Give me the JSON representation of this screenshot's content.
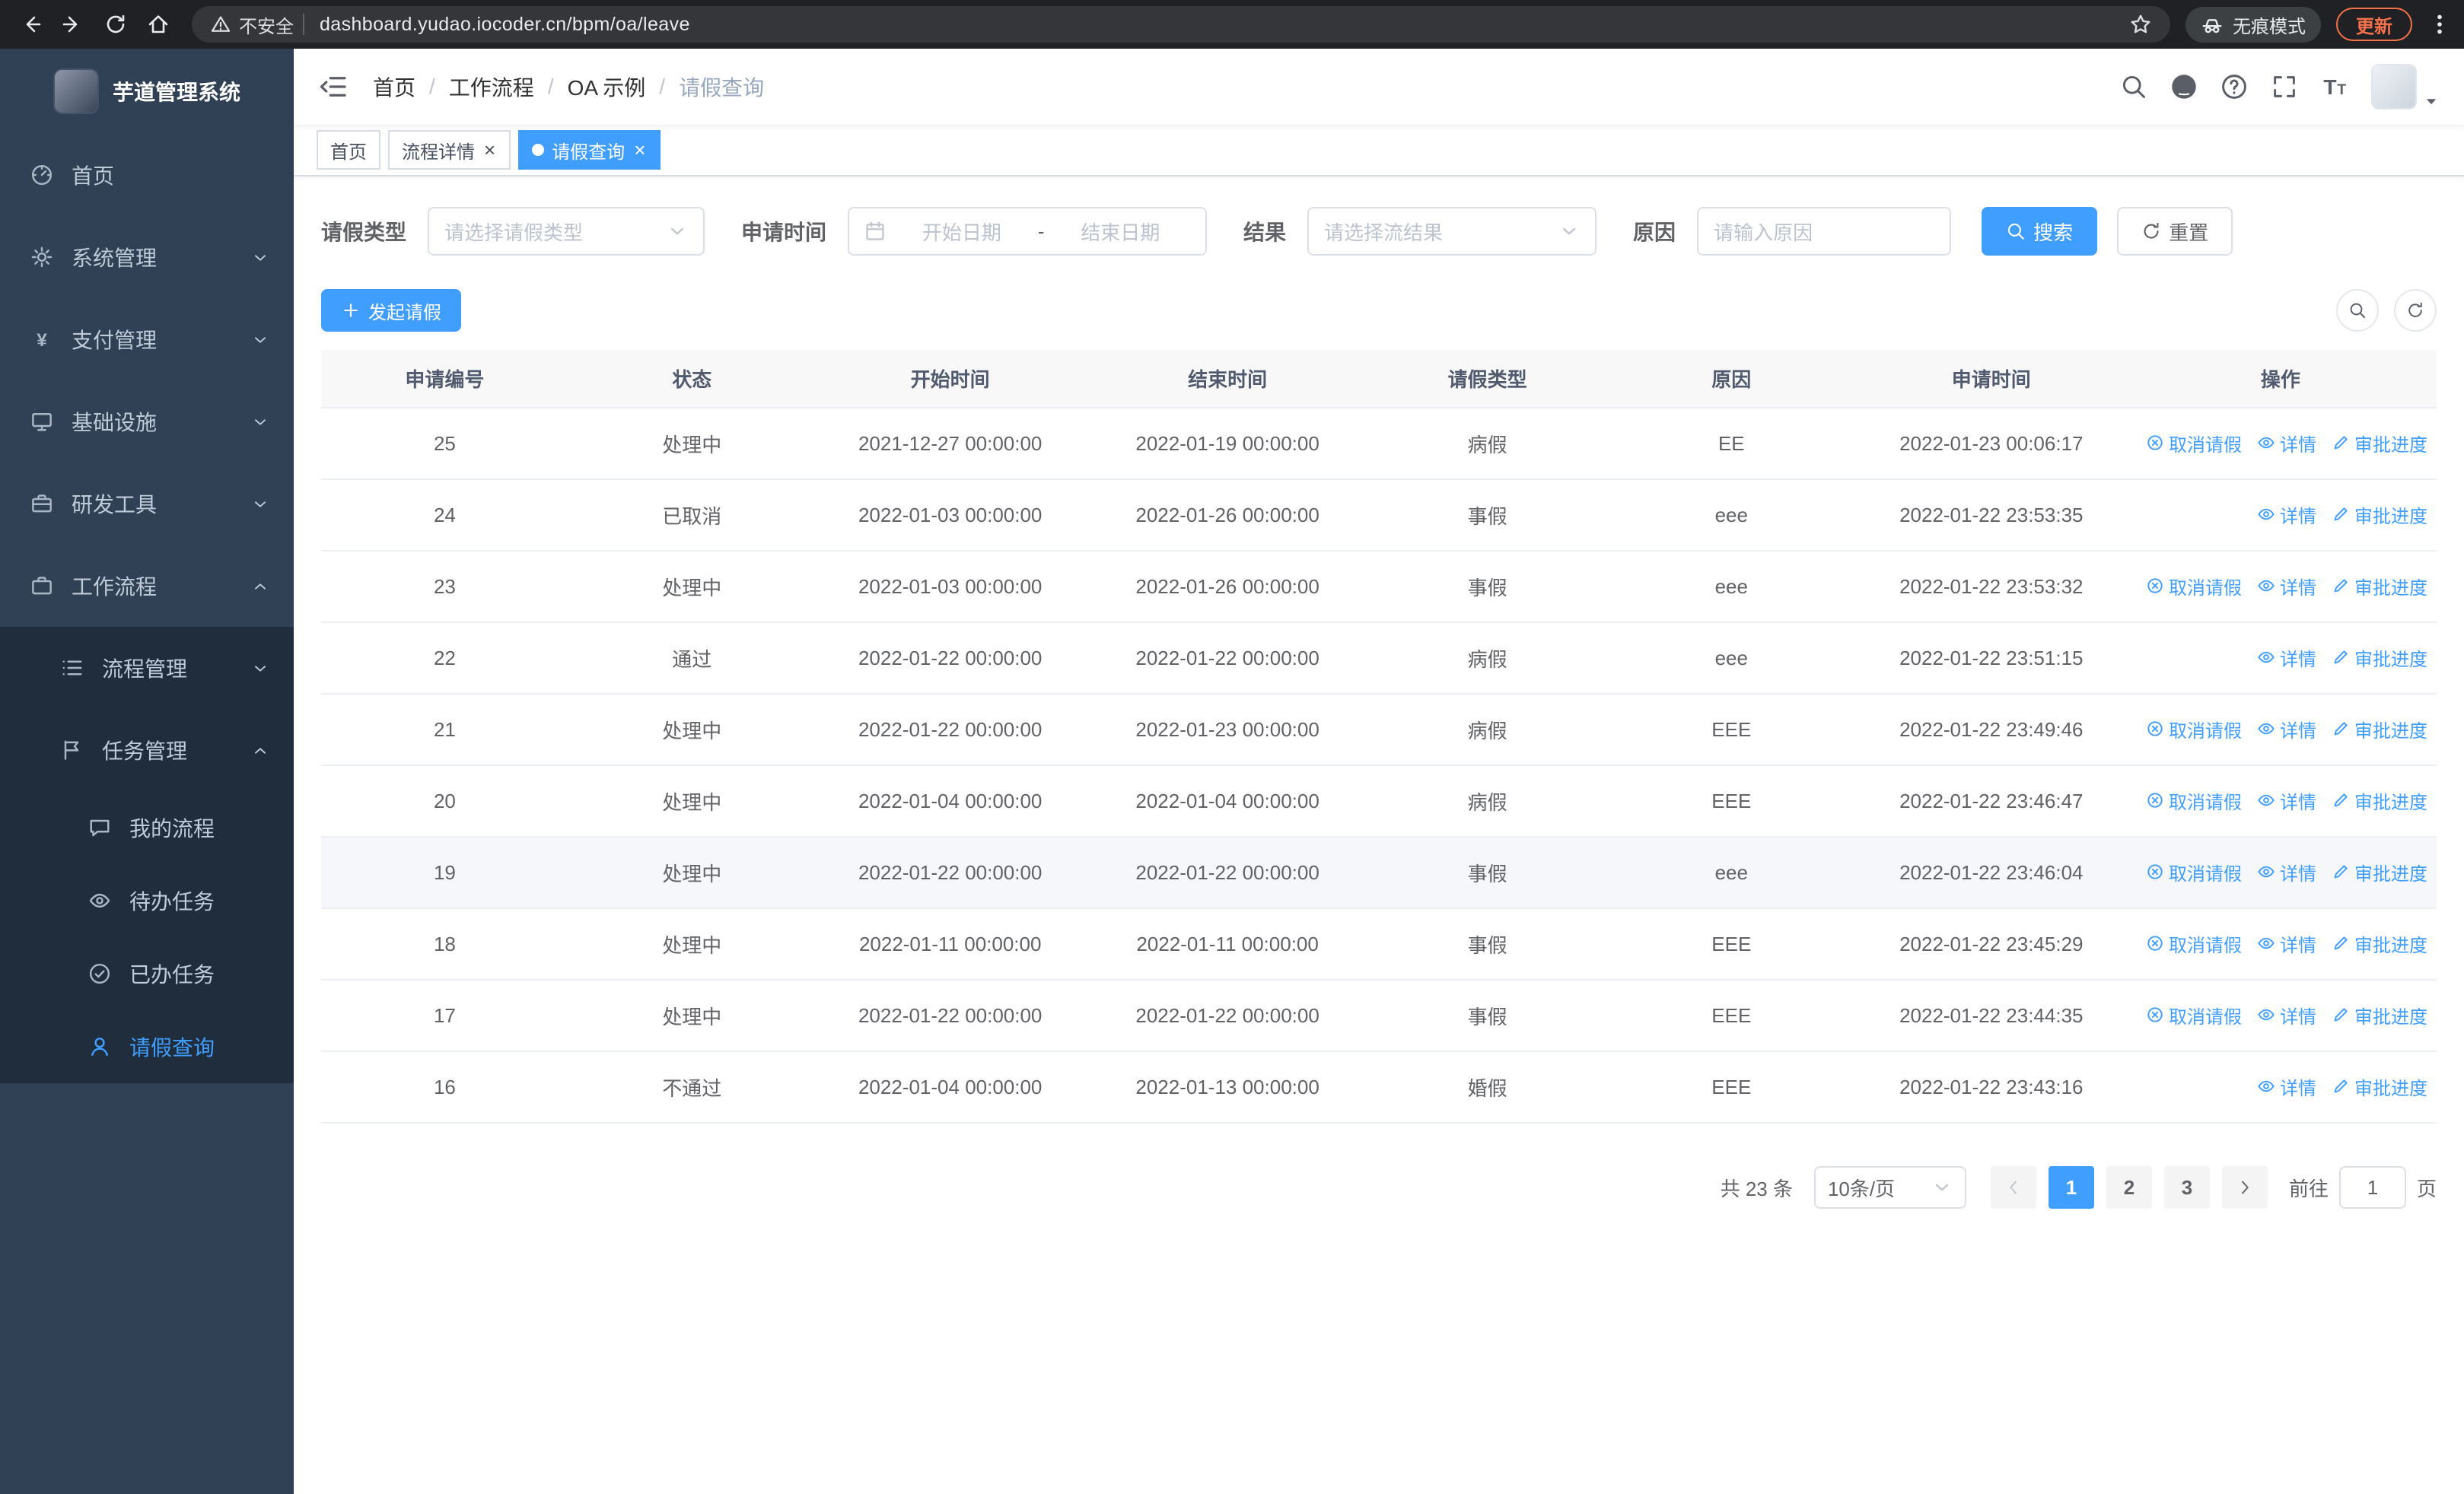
{
  "browser": {
    "security_warning": "不安全",
    "url": "dashboard.yudao.iocoder.cn/bpm/oa/leave",
    "incognito_label": "无痕模式",
    "update_label": "更新"
  },
  "colors": {
    "primary": "#409eff",
    "sidebar_bg": "#304156",
    "submenu_bg": "#1f2d3d",
    "update_accent": "#f4714a"
  },
  "sidebar": {
    "app_title": "芋道管理系统",
    "menu": [
      {
        "label": "首页",
        "icon": "dashboard",
        "level": 1
      },
      {
        "label": "系统管理",
        "icon": "gear",
        "level": 1,
        "arrow": "down"
      },
      {
        "label": "支付管理",
        "icon": "yen",
        "level": 1,
        "arrow": "down"
      },
      {
        "label": "基础设施",
        "icon": "monitor",
        "level": 1,
        "arrow": "down"
      },
      {
        "label": "研发工具",
        "icon": "tools",
        "level": 1,
        "arrow": "down"
      },
      {
        "label": "工作流程",
        "icon": "briefcase",
        "level": 1,
        "arrow": "up"
      },
      {
        "label": "流程管理",
        "icon": "list",
        "level": 2,
        "sub": true,
        "arrow": "down"
      },
      {
        "label": "任务管理",
        "icon": "flag",
        "level": 2,
        "sub": true,
        "arrow": "up"
      },
      {
        "label": "我的流程",
        "icon": "chat",
        "level": 3,
        "sub": true
      },
      {
        "label": "待办任务",
        "icon": "eye",
        "level": 3,
        "sub": true
      },
      {
        "label": "已办任务",
        "icon": "done",
        "level": 3,
        "sub": true
      },
      {
        "label": "请假查询",
        "icon": "user",
        "level": 3,
        "sub": true,
        "active": true
      }
    ]
  },
  "header": {
    "breadcrumb": [
      "首页",
      "工作流程",
      "OA 示例",
      "请假查询"
    ]
  },
  "tabs": [
    {
      "label": "首页",
      "closable": false,
      "active": false
    },
    {
      "label": "流程详情",
      "closable": true,
      "active": false
    },
    {
      "label": "请假查询",
      "closable": true,
      "active": true
    }
  ],
  "filters": {
    "leave_type_label": "请假类型",
    "leave_type_placeholder": "请选择请假类型",
    "apply_time_label": "申请时间",
    "start_date_placeholder": "开始日期",
    "range_separator": "-",
    "end_date_placeholder": "结束日期",
    "result_label": "结果",
    "result_placeholder": "请选择流结果",
    "reason_label": "原因",
    "reason_placeholder": "请输入原因",
    "search_button": "搜索",
    "reset_button": "重置"
  },
  "toolbar": {
    "create_button": "发起请假"
  },
  "table": {
    "columns": [
      "申请编号",
      "状态",
      "开始时间",
      "结束时间",
      "请假类型",
      "原因",
      "申请时间",
      "操作"
    ],
    "actions": {
      "cancel": "取消请假",
      "detail": "详情",
      "progress": "审批进度"
    },
    "rows": [
      {
        "id": "25",
        "status": "处理中",
        "start": "2021-12-27 00:00:00",
        "end": "2022-01-19 00:00:00",
        "type": "病假",
        "reason": "EE",
        "apply_time": "2022-01-23 00:06:17",
        "cancellable": true,
        "hover": false
      },
      {
        "id": "24",
        "status": "已取消",
        "start": "2022-01-03 00:00:00",
        "end": "2022-01-26 00:00:00",
        "type": "事假",
        "reason": "eee",
        "apply_time": "2022-01-22 23:53:35",
        "cancellable": false,
        "hover": false
      },
      {
        "id": "23",
        "status": "处理中",
        "start": "2022-01-03 00:00:00",
        "end": "2022-01-26 00:00:00",
        "type": "事假",
        "reason": "eee",
        "apply_time": "2022-01-22 23:53:32",
        "cancellable": true,
        "hover": false
      },
      {
        "id": "22",
        "status": "通过",
        "start": "2022-01-22 00:00:00",
        "end": "2022-01-22 00:00:00",
        "type": "病假",
        "reason": "eee",
        "apply_time": "2022-01-22 23:51:15",
        "cancellable": false,
        "hover": false
      },
      {
        "id": "21",
        "status": "处理中",
        "start": "2022-01-22 00:00:00",
        "end": "2022-01-23 00:00:00",
        "type": "病假",
        "reason": "EEE",
        "apply_time": "2022-01-22 23:49:46",
        "cancellable": true,
        "hover": false
      },
      {
        "id": "20",
        "status": "处理中",
        "start": "2022-01-04 00:00:00",
        "end": "2022-01-04 00:00:00",
        "type": "病假",
        "reason": "EEE",
        "apply_time": "2022-01-22 23:46:47",
        "cancellable": true,
        "hover": false
      },
      {
        "id": "19",
        "status": "处理中",
        "start": "2022-01-22 00:00:00",
        "end": "2022-01-22 00:00:00",
        "type": "事假",
        "reason": "eee",
        "apply_time": "2022-01-22 23:46:04",
        "cancellable": true,
        "hover": true
      },
      {
        "id": "18",
        "status": "处理中",
        "start": "2022-01-11 00:00:00",
        "end": "2022-01-11 00:00:00",
        "type": "事假",
        "reason": "EEE",
        "apply_time": "2022-01-22 23:45:29",
        "cancellable": true,
        "hover": false
      },
      {
        "id": "17",
        "status": "处理中",
        "start": "2022-01-22 00:00:00",
        "end": "2022-01-22 00:00:00",
        "type": "事假",
        "reason": "EEE",
        "apply_time": "2022-01-22 23:44:35",
        "cancellable": true,
        "hover": false
      },
      {
        "id": "16",
        "status": "不通过",
        "start": "2022-01-04 00:00:00",
        "end": "2022-01-13 00:00:00",
        "type": "婚假",
        "reason": "EEE",
        "apply_time": "2022-01-22 23:43:16",
        "cancellable": false,
        "hover": false
      }
    ]
  },
  "pagination": {
    "total_text": "共 23 条",
    "page_size": "10条/页",
    "pages": [
      "1",
      "2",
      "3"
    ],
    "active_page": "1",
    "goto_label": "前往",
    "goto_value": "1",
    "page_label": "页"
  }
}
